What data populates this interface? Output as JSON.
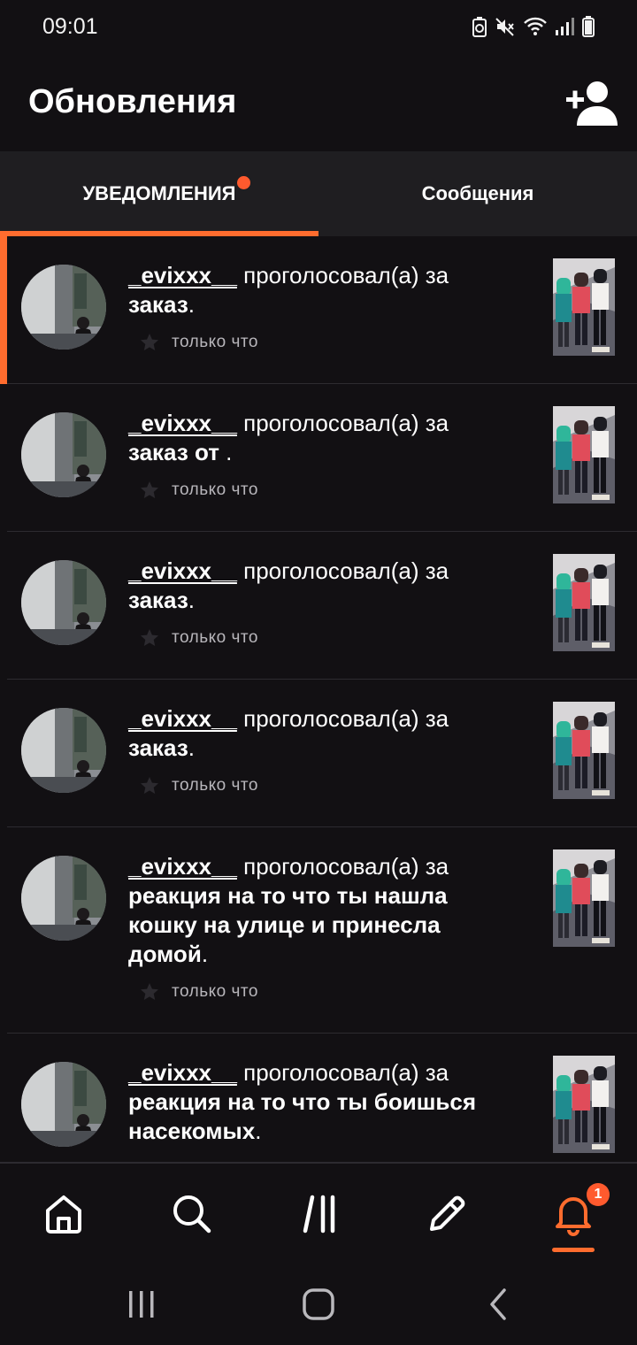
{
  "status_bar": {
    "time": "09:01",
    "icons": [
      "battery-saver-icon",
      "mute-icon",
      "wifi-icon",
      "signal-icon",
      "battery-icon"
    ]
  },
  "header": {
    "title": "Обновления",
    "add_user_icon": "add-user-icon"
  },
  "tabs": [
    {
      "label": "УВЕДОМЛЕНИЯ",
      "active": true,
      "has_dot": true
    },
    {
      "label": "Сообщения",
      "active": false,
      "has_dot": false
    }
  ],
  "notifications": [
    {
      "user": "_evixxx__",
      "action": " проголосовал(а) за ",
      "story": "заказ",
      "suffix": ".",
      "time": "только что",
      "unread": true
    },
    {
      "user": "_evixxx__",
      "action": " проголосовал(а) за ",
      "story": "заказ от ",
      "suffix": ".",
      "time": "только что",
      "unread": false
    },
    {
      "user": "_evixxx__",
      "action": " проголосовал(а) за ",
      "story": "заказ",
      "suffix": ".",
      "time": "только что",
      "unread": false
    },
    {
      "user": "_evixxx__",
      "action": " проголосовал(а) за ",
      "story": "заказ",
      "suffix": ".",
      "time": "только что",
      "unread": false
    },
    {
      "user": "_evixxx__",
      "action": " проголосовал(а) за ",
      "story": "реакция на то что ты нашла кошку на улице и принесла домой",
      "suffix": ".",
      "time": "только что",
      "unread": false
    },
    {
      "user": "_evixxx__",
      "action": " проголосовал(а) за ",
      "story": "реакция на то что ты боишься насекомых",
      "suffix": ".",
      "time": "",
      "unread": false
    }
  ],
  "bottom_nav": {
    "items": [
      "home-icon",
      "search-icon",
      "library-icon",
      "write-icon",
      "bell-icon"
    ],
    "active": "bell-icon",
    "badge": "1"
  },
  "colors": {
    "accent": "#ff6c2e",
    "badge": "#ff5a2e",
    "background": "#121013",
    "tab_bar": "#1f1e21"
  }
}
